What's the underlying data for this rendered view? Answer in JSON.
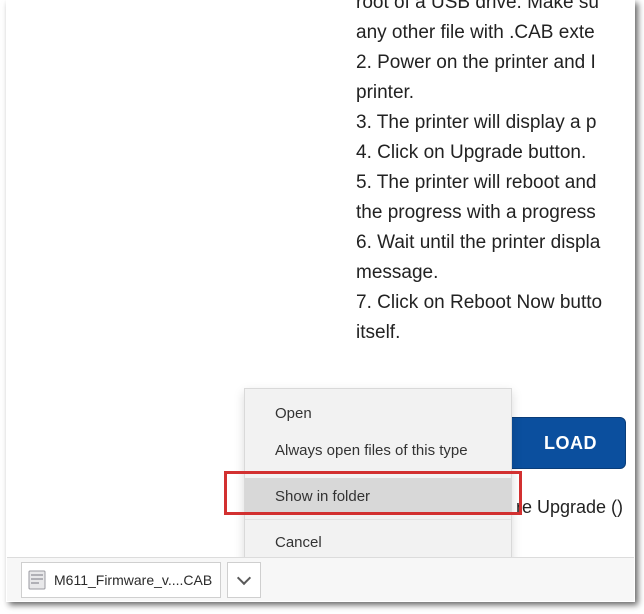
{
  "instructions": {
    "line1": "root of a USB drive. Make su",
    "line2": "any other file with .CAB exte",
    "line3": "2. Power on the printer and I",
    "line4": "printer.",
    "line5": "3. The printer will display a p",
    "line6": "4. Click on Upgrade button.",
    "line7": "5. The printer will reboot and",
    "line8": "the progress with a progress",
    "line9": "6. Wait until the printer displa",
    "line10": "message.",
    "line11": "7. Click on Reboot Now butto",
    "line12": "itself."
  },
  "download_button": "LOAD",
  "upgrade_text": "re Upgrade ()",
  "menu": {
    "open": "Open",
    "always": "Always open files of this type",
    "show": "Show in folder",
    "cancel": "Cancel"
  },
  "download_bar": {
    "filename": "M611_Firmware_v....CAB"
  }
}
